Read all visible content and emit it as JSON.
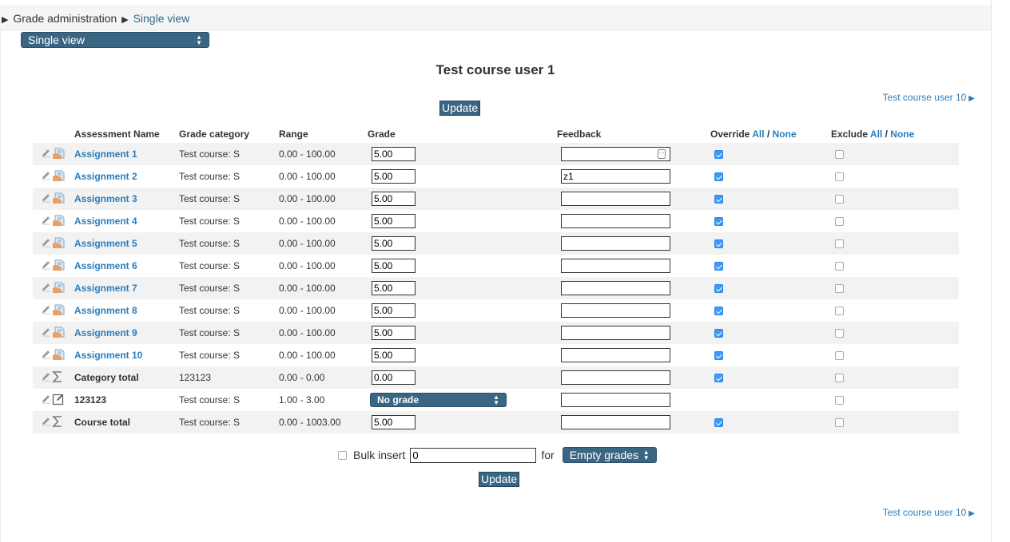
{
  "breadcrumb": {
    "parent": "Grade administration",
    "current": "Single view"
  },
  "view_select": {
    "value": "Single view"
  },
  "title": "Test course user 1",
  "next_user": {
    "label": "Test course user 10"
  },
  "update_label": "Update",
  "columns": {
    "name": "Assessment Name",
    "category": "Grade category",
    "range": "Range",
    "grade": "Grade",
    "feedback": "Feedback",
    "override": "Override",
    "exclude": "Exclude",
    "all": "All",
    "slash": "/",
    "none": "None"
  },
  "rows": [
    {
      "name": "Assignment 1",
      "type": "assignment",
      "link": true,
      "category": "Test course: S",
      "range": "0.00 - 100.00",
      "grade": "5.00",
      "feedback": "",
      "override": true,
      "exclude": false
    },
    {
      "name": "Assignment 2",
      "type": "assignment",
      "link": true,
      "category": "Test course: S",
      "range": "0.00 - 100.00",
      "grade": "5.00",
      "feedback": "z1",
      "override": true,
      "exclude": false
    },
    {
      "name": "Assignment 3",
      "type": "assignment",
      "link": true,
      "category": "Test course: S",
      "range": "0.00 - 100.00",
      "grade": "5.00",
      "feedback": "",
      "override": true,
      "exclude": false
    },
    {
      "name": "Assignment 4",
      "type": "assignment",
      "link": true,
      "category": "Test course: S",
      "range": "0.00 - 100.00",
      "grade": "5.00",
      "feedback": "",
      "override": true,
      "exclude": false
    },
    {
      "name": "Assignment 5",
      "type": "assignment",
      "link": true,
      "category": "Test course: S",
      "range": "0.00 - 100.00",
      "grade": "5.00",
      "feedback": "",
      "override": true,
      "exclude": false
    },
    {
      "name": "Assignment 6",
      "type": "assignment",
      "link": true,
      "category": "Test course: S",
      "range": "0.00 - 100.00",
      "grade": "5.00",
      "feedback": "",
      "override": true,
      "exclude": false
    },
    {
      "name": "Assignment 7",
      "type": "assignment",
      "link": true,
      "category": "Test course: S",
      "range": "0.00 - 100.00",
      "grade": "5.00",
      "feedback": "",
      "override": true,
      "exclude": false
    },
    {
      "name": "Assignment 8",
      "type": "assignment",
      "link": true,
      "category": "Test course: S",
      "range": "0.00 - 100.00",
      "grade": "5.00",
      "feedback": "",
      "override": true,
      "exclude": false
    },
    {
      "name": "Assignment 9",
      "type": "assignment",
      "link": true,
      "category": "Test course: S",
      "range": "0.00 - 100.00",
      "grade": "5.00",
      "feedback": "",
      "override": true,
      "exclude": false
    },
    {
      "name": "Assignment 10",
      "type": "assignment",
      "link": true,
      "category": "Test course: S",
      "range": "0.00 - 100.00",
      "grade": "5.00",
      "feedback": "",
      "override": true,
      "exclude": false
    },
    {
      "name": "Category total",
      "type": "sum",
      "link": false,
      "category": "123123",
      "range": "0.00 - 0.00",
      "grade": "0.00",
      "feedback": "",
      "override": true,
      "exclude": false
    },
    {
      "name": "123123",
      "type": "manual",
      "link": false,
      "category": "Test course: S",
      "range": "1.00 - 3.00",
      "grade_select": "No grade",
      "feedback": "",
      "override": null,
      "exclude": false
    },
    {
      "name": "Course total",
      "type": "sum",
      "link": false,
      "category": "Test course: S",
      "range": "0.00 - 1003.00",
      "grade": "5.00",
      "feedback": "",
      "override": true,
      "exclude": false
    }
  ],
  "bulk": {
    "label": "Bulk insert",
    "value": "0",
    "for_label": "for",
    "select_value": "Empty grades"
  },
  "icons": {
    "edit": "pencil-icon",
    "assignment": "assignment-icon",
    "sum": "sigma-icon",
    "manual": "manual-item-icon",
    "next": "right-triangle-icon"
  },
  "colors": {
    "accent": "#3a6684",
    "link": "#2b7dbb",
    "checkbox": "#3b99fc"
  }
}
